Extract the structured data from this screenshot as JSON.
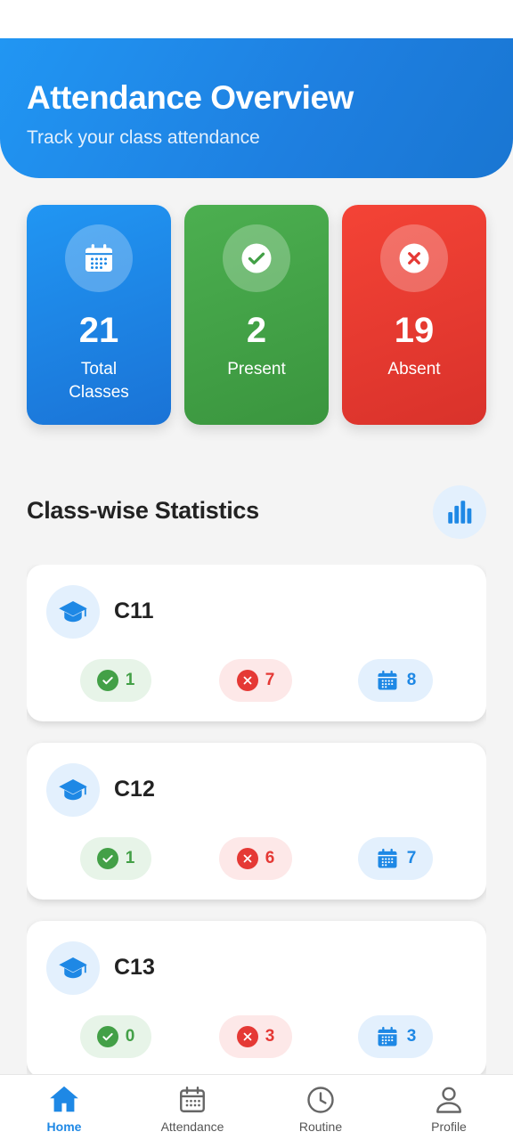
{
  "header": {
    "title": "Attendance Overview",
    "subtitle": "Track your class attendance"
  },
  "summary": [
    {
      "value": "21",
      "label": "Total Classes",
      "icon": "calendar-icon",
      "color": "#2196f3"
    },
    {
      "value": "2",
      "label": "Present",
      "icon": "check-icon",
      "color": "#4caf50"
    },
    {
      "value": "19",
      "label": "Absent",
      "icon": "close-icon",
      "color": "#f44336"
    }
  ],
  "section": {
    "title": "Class-wise Statistics",
    "action_icon": "bar-chart-icon"
  },
  "classes": [
    {
      "name": "C11",
      "present": "1",
      "absent": "7",
      "total": "8"
    },
    {
      "name": "C12",
      "present": "1",
      "absent": "6",
      "total": "7"
    },
    {
      "name": "C13",
      "present": "0",
      "absent": "3",
      "total": "3"
    }
  ],
  "nav": [
    {
      "label": "Home",
      "icon": "home-icon",
      "active": true
    },
    {
      "label": "Attendance",
      "icon": "calendar-icon",
      "active": false
    },
    {
      "label": "Routine",
      "icon": "clock-icon",
      "active": false
    },
    {
      "label": "Profile",
      "icon": "person-icon",
      "active": false
    }
  ],
  "colors": {
    "primary": "#1e88e5",
    "present": "#43a047",
    "absent": "#e53935"
  }
}
